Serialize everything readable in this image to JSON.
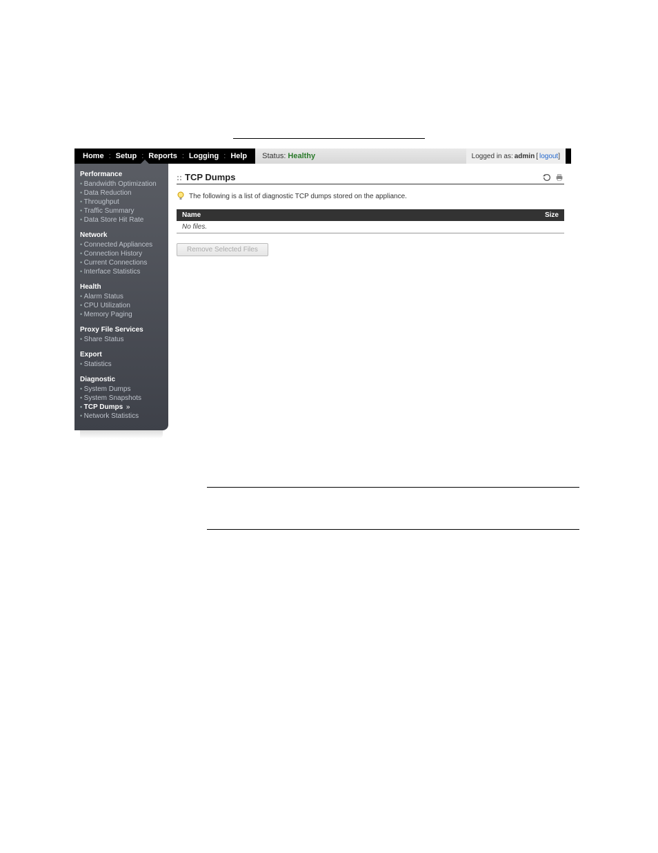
{
  "navbar": {
    "items": [
      "Home",
      "Setup",
      "Reports",
      "Logging",
      "Help"
    ]
  },
  "status": {
    "label": "Status:",
    "value": "Healthy"
  },
  "login": {
    "prefix": "Logged in as:",
    "user": "admin",
    "logout": "logout"
  },
  "sidebar": {
    "sections": [
      {
        "title": "Performance",
        "items": [
          {
            "label": "Bandwidth Optimization",
            "active": false
          },
          {
            "label": "Data Reduction",
            "active": false
          },
          {
            "label": "Throughput",
            "active": false
          },
          {
            "label": "Traffic Summary",
            "active": false
          },
          {
            "label": "Data Store Hit Rate",
            "active": false
          }
        ]
      },
      {
        "title": "Network",
        "items": [
          {
            "label": "Connected Appliances",
            "active": false
          },
          {
            "label": "Connection History",
            "active": false
          },
          {
            "label": "Current Connections",
            "active": false
          },
          {
            "label": "Interface Statistics",
            "active": false
          }
        ]
      },
      {
        "title": "Health",
        "items": [
          {
            "label": "Alarm Status",
            "active": false
          },
          {
            "label": "CPU Utilization",
            "active": false
          },
          {
            "label": "Memory Paging",
            "active": false
          }
        ]
      },
      {
        "title": "Proxy File Services",
        "items": [
          {
            "label": "Share Status",
            "active": false
          }
        ]
      },
      {
        "title": "Export",
        "items": [
          {
            "label": "Statistics",
            "active": false
          }
        ]
      },
      {
        "title": "Diagnostic",
        "items": [
          {
            "label": "System Dumps",
            "active": false
          },
          {
            "label": "System Snapshots",
            "active": false
          },
          {
            "label": "TCP Dumps",
            "active": true
          },
          {
            "label": "Network Statistics",
            "active": false
          }
        ]
      }
    ]
  },
  "page": {
    "title_prefix": "::",
    "title": "TCP Dumps",
    "hint": "The following is a list of diagnostic TCP dumps stored on the appliance."
  },
  "table": {
    "headers": [
      "Name",
      "Size"
    ],
    "empty": "No files."
  },
  "buttons": {
    "remove": "Remove Selected Files"
  }
}
